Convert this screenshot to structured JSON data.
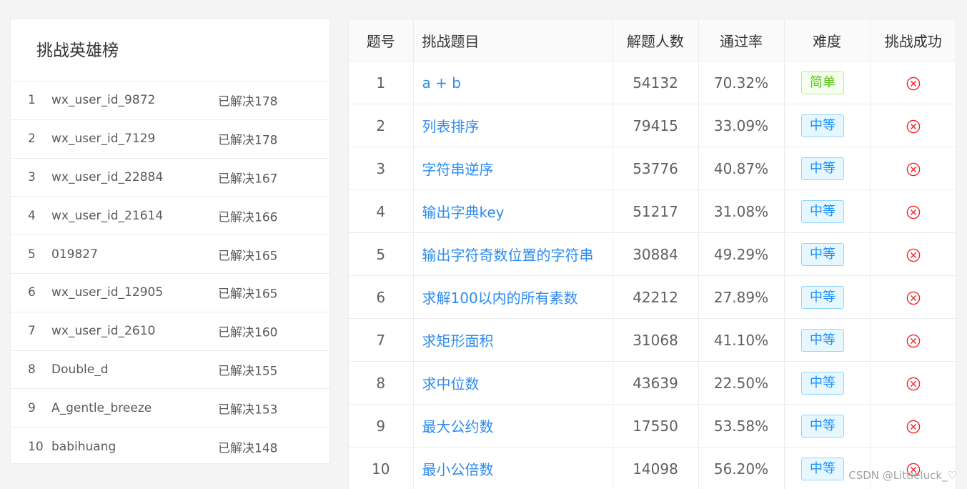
{
  "leaderboard": {
    "title": "挑战英雄榜",
    "rows": [
      {
        "rank": "1",
        "user": "wx_user_id_9872",
        "solved": "已解决178"
      },
      {
        "rank": "2",
        "user": "wx_user_id_7129",
        "solved": "已解决178"
      },
      {
        "rank": "3",
        "user": "wx_user_id_22884",
        "solved": "已解决167"
      },
      {
        "rank": "4",
        "user": "wx_user_id_21614",
        "solved": "已解决166"
      },
      {
        "rank": "5",
        "user": "019827",
        "solved": "已解决165"
      },
      {
        "rank": "6",
        "user": "wx_user_id_12905",
        "solved": "已解决165"
      },
      {
        "rank": "7",
        "user": "wx_user_id_2610",
        "solved": "已解决160"
      },
      {
        "rank": "8",
        "user": "Double_d",
        "solved": "已解决155"
      },
      {
        "rank": "9",
        "user": "A_gentle_breeze",
        "solved": "已解决153"
      },
      {
        "rank": "10",
        "user": "babihuang",
        "solved": "已解决148"
      }
    ]
  },
  "problems": {
    "headers": {
      "id": "题号",
      "title": "挑战题目",
      "solvers": "解题人数",
      "rate": "通过率",
      "difficulty": "难度",
      "success": "挑战成功"
    },
    "rows": [
      {
        "id": "1",
        "title": "a + b",
        "solvers": "54132",
        "rate": "70.32%",
        "difficulty": "简单",
        "level": "easy",
        "status_icon": "close-circle-icon"
      },
      {
        "id": "2",
        "title": "列表排序",
        "solvers": "79415",
        "rate": "33.09%",
        "difficulty": "中等",
        "level": "mid",
        "status_icon": "close-circle-icon"
      },
      {
        "id": "3",
        "title": "字符串逆序",
        "solvers": "53776",
        "rate": "40.87%",
        "difficulty": "中等",
        "level": "mid",
        "status_icon": "close-circle-icon"
      },
      {
        "id": "4",
        "title": "输出字典key",
        "solvers": "51217",
        "rate": "31.08%",
        "difficulty": "中等",
        "level": "mid",
        "status_icon": "close-circle-icon"
      },
      {
        "id": "5",
        "title": "输出字符奇数位置的字符串",
        "solvers": "30884",
        "rate": "49.29%",
        "difficulty": "中等",
        "level": "mid",
        "status_icon": "close-circle-icon"
      },
      {
        "id": "6",
        "title": "求解100以内的所有素数",
        "solvers": "42212",
        "rate": "27.89%",
        "difficulty": "中等",
        "level": "mid",
        "status_icon": "close-circle-icon"
      },
      {
        "id": "7",
        "title": "求矩形面积",
        "solvers": "31068",
        "rate": "41.10%",
        "difficulty": "中等",
        "level": "mid",
        "status_icon": "close-circle-icon"
      },
      {
        "id": "8",
        "title": "求中位数",
        "solvers": "43639",
        "rate": "22.50%",
        "difficulty": "中等",
        "level": "mid",
        "status_icon": "close-circle-icon"
      },
      {
        "id": "9",
        "title": "最大公约数",
        "solvers": "17550",
        "rate": "53.58%",
        "difficulty": "中等",
        "level": "mid",
        "status_icon": "close-circle-icon"
      },
      {
        "id": "10",
        "title": "最小公倍数",
        "solvers": "14098",
        "rate": "56.20%",
        "difficulty": "中等",
        "level": "mid",
        "status_icon": "close-circle-icon"
      }
    ]
  },
  "colors": {
    "link": "#2d8cf0",
    "fail": "#f5222d",
    "easy": "#52c41a",
    "mid": "#1890ff"
  },
  "watermark": "CSDN @Littleluck_♡"
}
